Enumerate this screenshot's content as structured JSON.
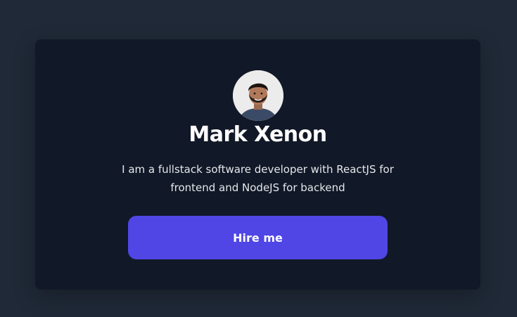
{
  "profile": {
    "avatar_icon": "person-photo-icon",
    "name": "Mark Xenon",
    "bio": "I am a fullstack software developer with ReactJS for frontend and NodeJS for backend",
    "hire_label": "Hire me"
  },
  "colors": {
    "background": "#1f2937",
    "card": "#111827",
    "accent": "#4f46e5",
    "text": "#ffffff"
  }
}
